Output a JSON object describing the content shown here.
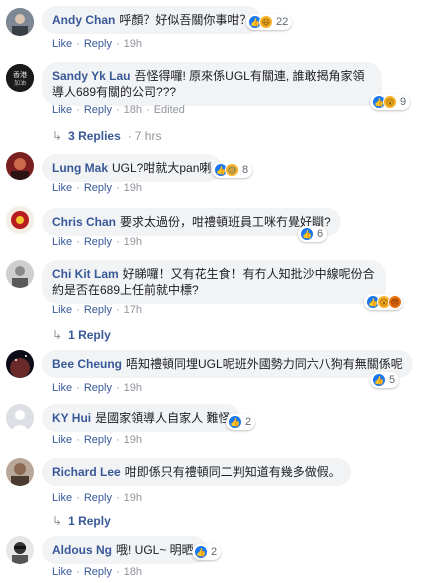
{
  "comments": [
    {
      "author": "Andy Chan",
      "text": "呼顏？好似吾關你事咁？",
      "like": "Like",
      "reply": "Reply",
      "time": "19h",
      "reaction_count": "22"
    },
    {
      "author": "Sandy Yk Lau",
      "text": "吾怪得囉! 原來係UGL有關連, 誰敢揭角家領導人689有關的公司???",
      "like": "Like",
      "reply": "Reply",
      "time": "18h",
      "edited": "Edited",
      "reaction_count": "9",
      "replies": {
        "label": "3 Replies",
        "time": "7 hrs"
      }
    },
    {
      "author": "Lung Mak",
      "text": "UGL?咁就大pan喇",
      "like": "Like",
      "reply": "Reply",
      "time": "19h",
      "reaction_count": "8"
    },
    {
      "author": "Chris Chan",
      "text": "要求太過份，咁禮頓班員工咪冇覺好瞓?",
      "like": "Like",
      "reply": "Reply",
      "time": "19h",
      "reaction_count": "6"
    },
    {
      "author": "Chi Kit Lam",
      "text": "好睇囉！又有花生食！有冇人知批沙中線呢份合約是否在689上任前就中標?",
      "like": "Like",
      "reply": "Reply",
      "time": "17h",
      "reaction_count": "",
      "replies": {
        "label": "1 Reply",
        "time": ""
      }
    },
    {
      "author": "Bee Cheung",
      "text": "唔知禮頓同埋UGL呢班外國勢力同六八狗有無關係呢",
      "like": "Like",
      "reply": "Reply",
      "time": "19h",
      "reaction_count": "5"
    },
    {
      "author": "KY Hui",
      "text": "是國家領導人自家人 難怪",
      "like": "Like",
      "reply": "Reply",
      "time": "19h",
      "reaction_count": "2"
    },
    {
      "author": "Richard Lee",
      "text": "咁即係只有禮頓同二判知道有幾多做假。",
      "like": "Like",
      "reply": "Reply",
      "time": "19h",
      "reaction_count": "",
      "replies": {
        "label": "1 Reply",
        "time": ""
      }
    },
    {
      "author": "Aldous Ng",
      "text": "哦! UGL~ 明晒!",
      "like": "Like",
      "reply": "Reply",
      "time": "18h",
      "reaction_count": "2"
    }
  ],
  "colors": {
    "author": "#385898",
    "bubble": "#f2f3f5",
    "meta": "#90949c",
    "like_blue": "#1877f2",
    "emoji_yellow": "#f7b125"
  },
  "icons": {
    "like": "thumbs-up-icon",
    "haha": "haha-icon",
    "wow": "wow-icon",
    "sad": "sad-icon",
    "angry": "angry-icon",
    "reply_arrow": "reply-arrow-icon"
  }
}
